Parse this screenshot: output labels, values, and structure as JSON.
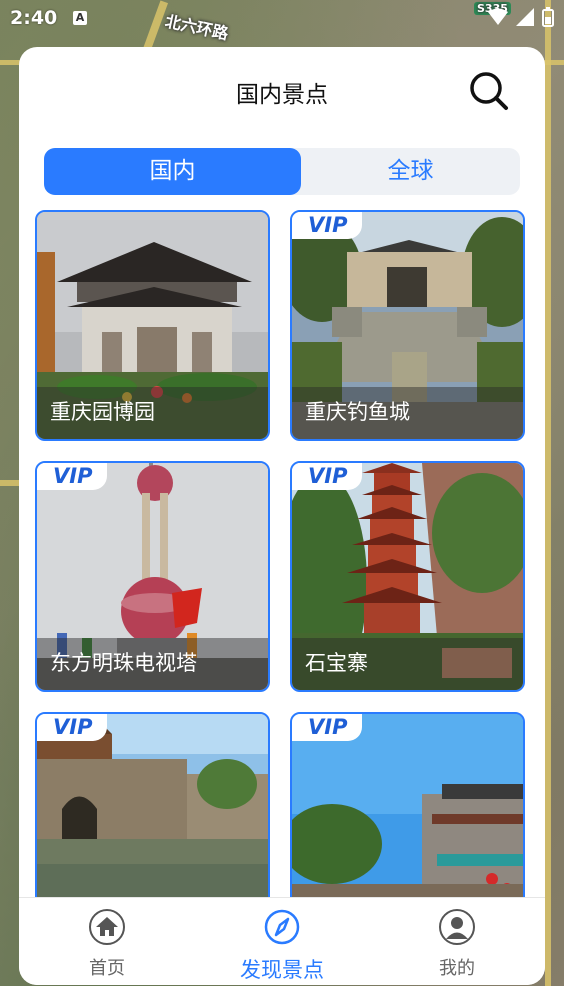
{
  "status_bar": {
    "time": "2:40",
    "notification_letter": "A"
  },
  "map": {
    "labels": [
      "北六环路",
      "S335"
    ]
  },
  "panel": {
    "title": "国内景点"
  },
  "tabs": [
    {
      "label": "国内",
      "active": true
    },
    {
      "label": "全球",
      "active": false
    }
  ],
  "spots": [
    {
      "name": "重庆园博园",
      "vip": false
    },
    {
      "name": "重庆钓鱼城",
      "vip": true
    },
    {
      "name": "东方明珠电视塔",
      "vip": true
    },
    {
      "name": "石宝寨",
      "vip": true
    },
    {
      "name": "",
      "vip": true
    },
    {
      "name": "",
      "vip": true
    }
  ],
  "vip_label": "VIP",
  "bottom_nav": [
    {
      "label": "首页",
      "icon": "home-icon",
      "active": false
    },
    {
      "label": "发现景点",
      "icon": "compass-icon",
      "active": true
    },
    {
      "label": "我的",
      "icon": "user-icon",
      "active": false
    }
  ],
  "colors": {
    "accent": "#2a7bff",
    "vip_text": "#1f5fd6"
  }
}
